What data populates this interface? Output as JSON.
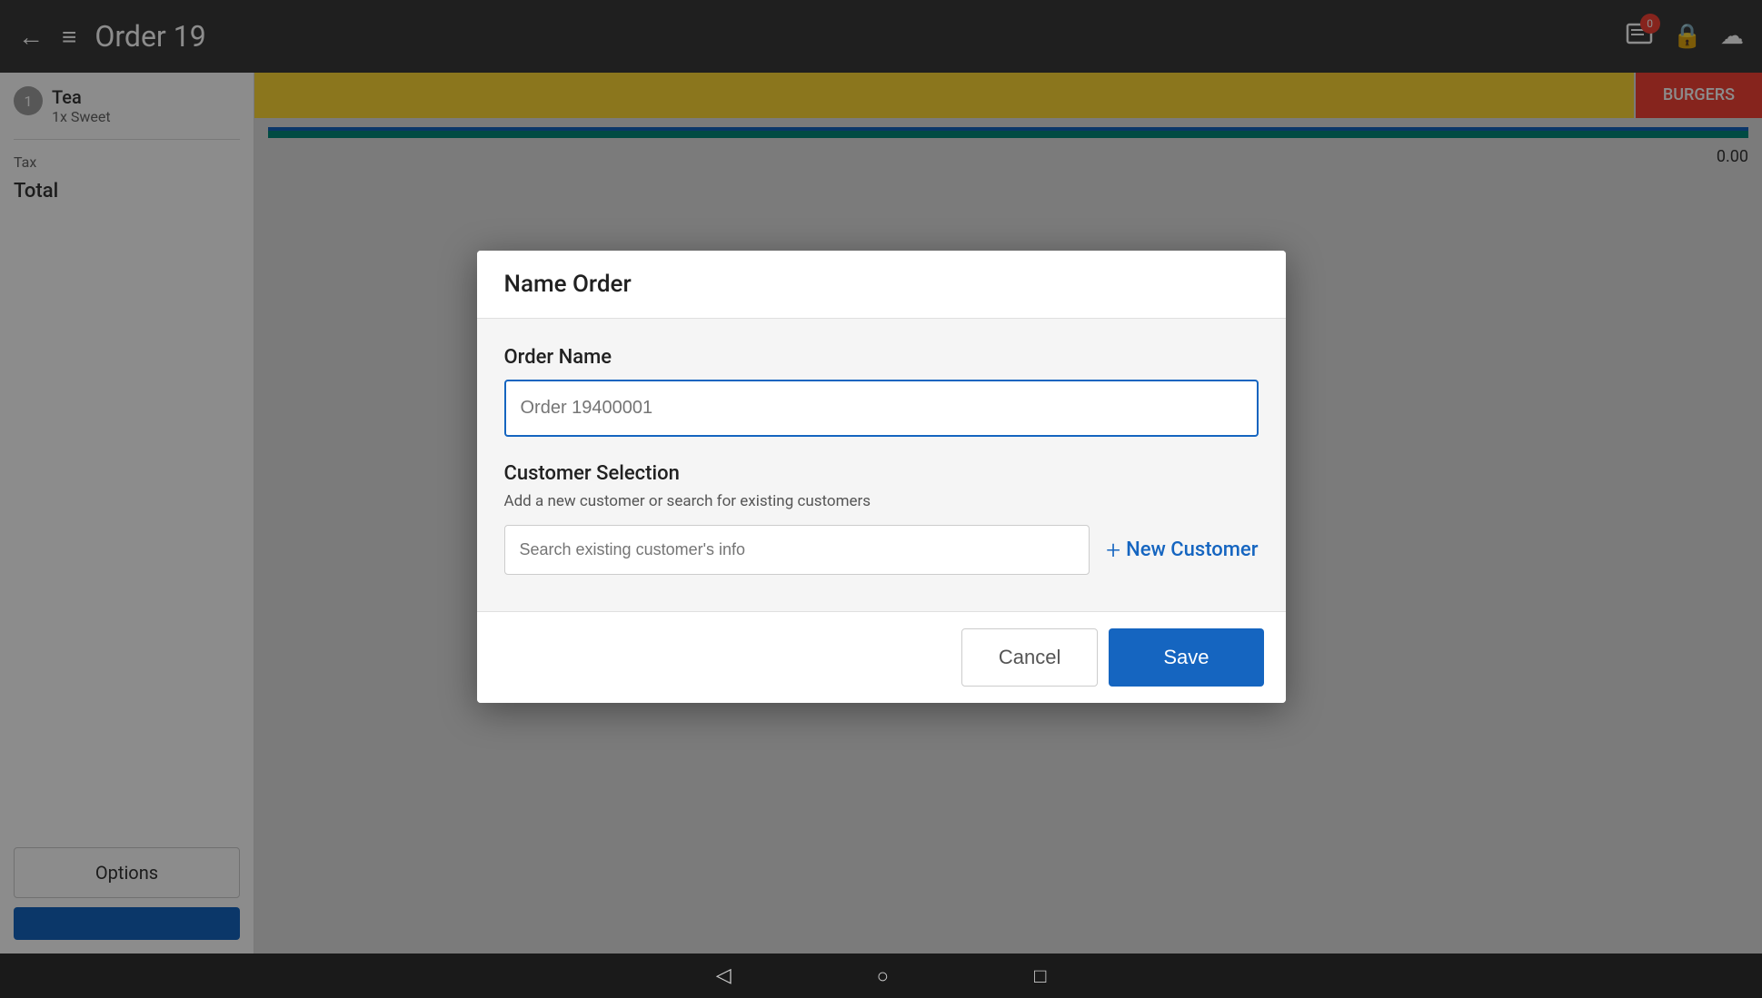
{
  "app": {
    "title": "Order 19",
    "topbar": {
      "back_icon": "←",
      "hamburger_icon": "≡",
      "notification_count": "0",
      "lock_icon": "🔒",
      "cloud_icon": "☁"
    }
  },
  "left_panel": {
    "order_items": [
      {
        "number": "1",
        "name": "Tea",
        "qty": "1x  Sweet"
      }
    ],
    "tax_label": "Tax",
    "total_label": "Total",
    "options_btn": "Options",
    "pay_btn_label": ""
  },
  "right_panel": {
    "categories": [
      {
        "label": "BURGERS",
        "style": "red"
      }
    ],
    "price": "0.00"
  },
  "dialog": {
    "title": "Name Order",
    "order_name_label": "Order Name",
    "order_name_placeholder": "Order 19400001",
    "customer_section_label": "Customer Selection",
    "customer_section_desc": "Add a new customer or search for existing customers",
    "customer_search_placeholder": "Search existing customer's info",
    "new_customer_btn": "New Customer",
    "plus_icon": "+",
    "cancel_btn": "Cancel",
    "save_btn": "Save"
  },
  "bottom_nav": {
    "back_icon": "◁",
    "home_icon": "○",
    "recent_icon": "□"
  }
}
